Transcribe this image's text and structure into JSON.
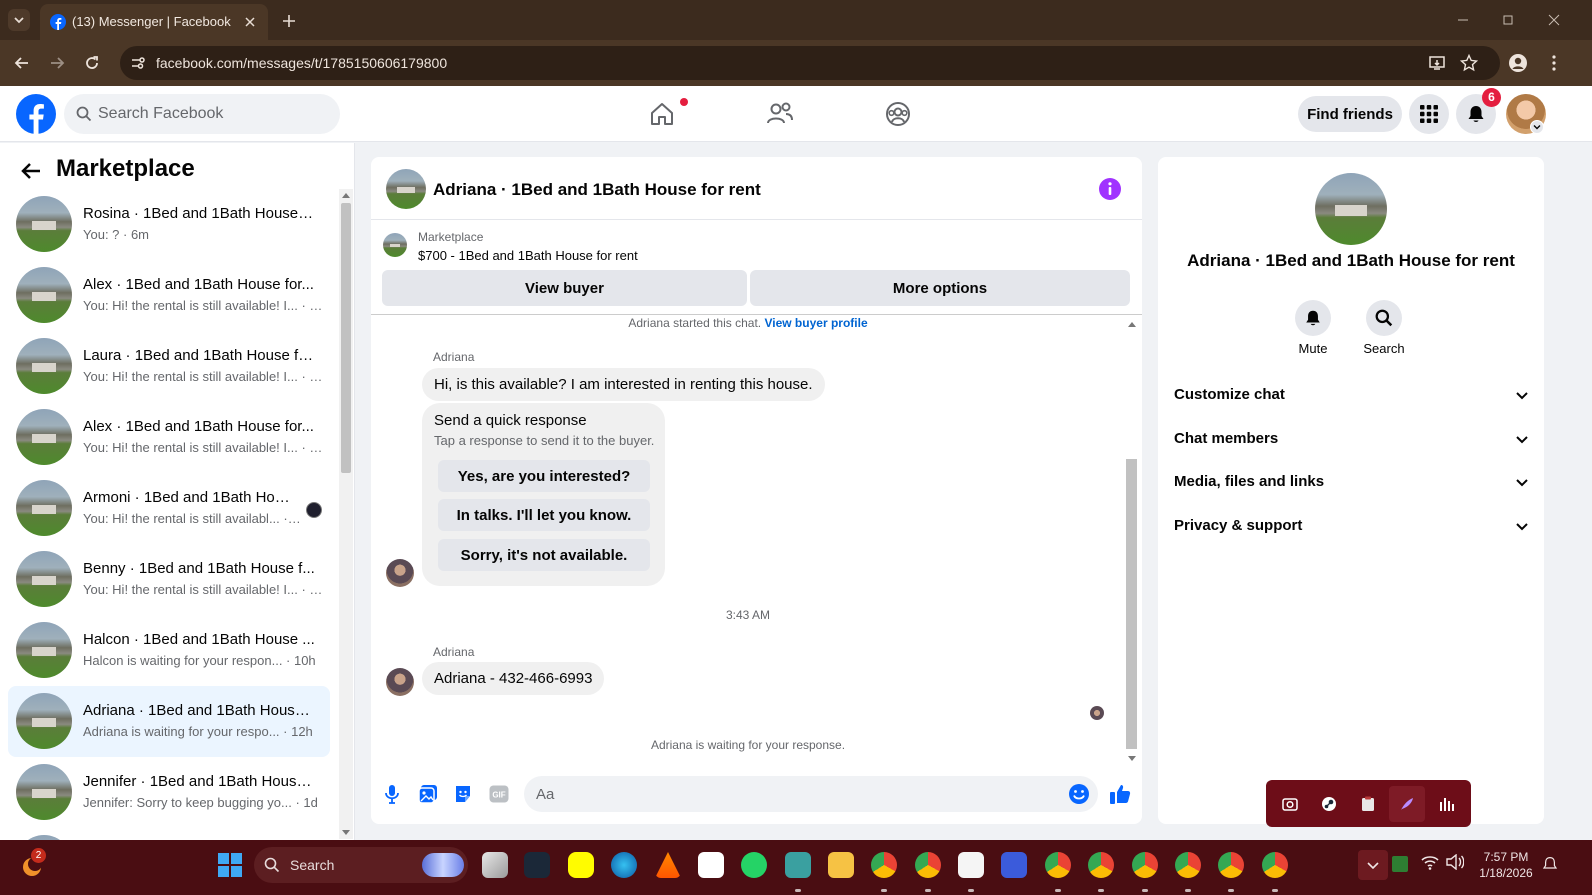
{
  "browser": {
    "tab_title": "(13) Messenger | Facebook",
    "url": "facebook.com/messages/t/1785150606179800",
    "icons": [
      "tab-dropdown-icon",
      "facebook-favicon-icon",
      "close-tab-icon",
      "new-tab-icon",
      "back-icon",
      "forward-icon",
      "reload-icon",
      "site-info-icon",
      "install-app-icon",
      "bookmark-star-icon",
      "profile-icon",
      "menu-icon"
    ]
  },
  "fb_header": {
    "search_placeholder": "Search Facebook",
    "find_friends": "Find friends",
    "notification_count": "6"
  },
  "sidebar": {
    "title": "Marketplace",
    "conversations": [
      {
        "name": "Rosina · 1Bed and 1Bath House f...",
        "preview": "You: ? · 6m",
        "active": false
      },
      {
        "name": "Alex · 1Bed and 1Bath House for...",
        "preview": "You: Hi! the rental is still available! I... · 1h",
        "active": false
      },
      {
        "name": "Laura · 1Bed and 1Bath House fo...",
        "preview": "You: Hi! the rental is still available! I... · 1h",
        "active": false
      },
      {
        "name": "Alex · 1Bed and 1Bath House for...",
        "preview": "You: Hi! the rental is still available! I... · 1h",
        "active": false
      },
      {
        "name": "Armoni · 1Bed and 1Bath Hou...",
        "preview": "You: Hi! the rental is still availabl... · 1h",
        "active": false
      },
      {
        "name": "Benny · 1Bed and 1Bath House f...",
        "preview": "You: Hi! the rental is still available! I... · 1h",
        "active": false
      },
      {
        "name": "Halcon · 1Bed and 1Bath House ...",
        "preview": "Halcon is waiting for your respon... · 10h",
        "active": false
      },
      {
        "name": "Adriana · 1Bed and 1Bath House...",
        "preview": "Adriana is waiting for your respo... · 12h",
        "active": true
      },
      {
        "name": "Jennifer · 1Bed and 1Bath House...",
        "preview": "Jennifer: Sorry to keep bugging yo... · 1d",
        "active": false
      }
    ]
  },
  "chat": {
    "title": "Adriana · 1Bed and 1Bath House for rent",
    "listing_label": "Marketplace",
    "listing_price": "$700 - 1Bed and 1Bath House for rent",
    "view_buyer": "View buyer",
    "more_options": "More options",
    "started_text": "Adriana started this chat.",
    "buyer_profile_link": "View buyer profile",
    "sender1": "Adriana",
    "message1": "Hi, is this available? I am interested in renting this house.",
    "quick_title": "Send a quick response",
    "quick_sub": "Tap a response to send it to the buyer.",
    "quick_1": "Yes, are you interested?",
    "quick_2": "In talks. I'll let you know.",
    "quick_3": "Sorry, it's not available.",
    "timestamp": "3:43 AM",
    "sender2": "Adriana",
    "message2": "Adriana - 432-466-6993",
    "waiting": "Adriana is waiting for your response.",
    "input_placeholder": "Aa"
  },
  "right_panel": {
    "title": "Adriana · 1Bed and 1Bath House for rent",
    "mute": "Mute",
    "search": "Search",
    "rows": [
      "Customize chat",
      "Chat members",
      "Media, files and links",
      "Privacy & support"
    ]
  },
  "taskbar": {
    "weather_badge": "2",
    "search_label": "Search",
    "time": "7:57 PM",
    "date": "1/18/2026"
  },
  "colors": {
    "brand": "#0866ff",
    "accent_purple": "#a033ff",
    "active_row": "#ebf5ff",
    "taskbar": "#4a0d12",
    "browser_frame": "#3c2b1e"
  }
}
